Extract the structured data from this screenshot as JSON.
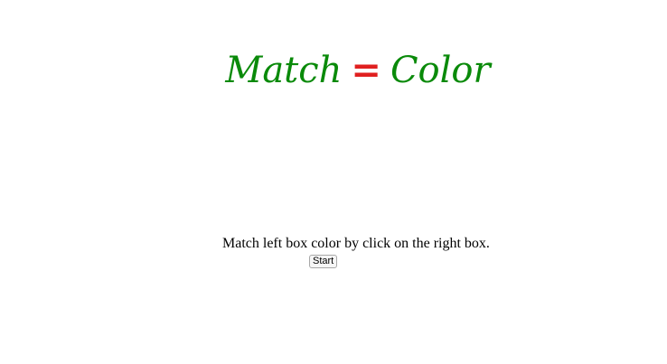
{
  "header": {
    "title_left": "Match",
    "title_sep": "=",
    "title_right": "Color"
  },
  "game": {
    "instructions": "Match left box color by click on the right box.",
    "start_label": "Start"
  },
  "colors": {
    "title": "#0a8a0a",
    "equals": "#e02020",
    "background": "#ffffff"
  }
}
